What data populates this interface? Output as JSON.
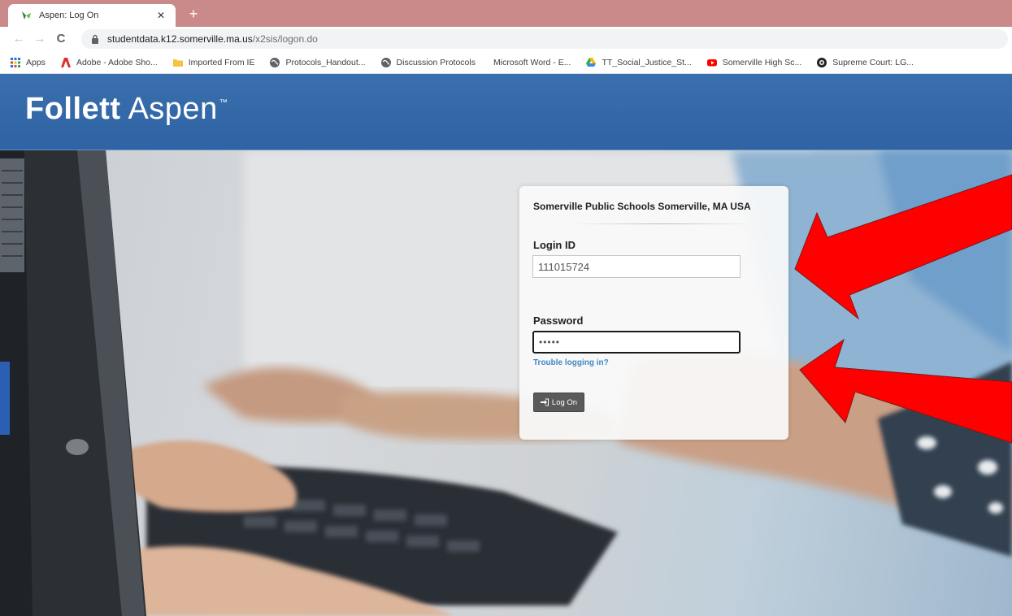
{
  "browser": {
    "tab": {
      "title": "Aspen: Log On",
      "icon": "aspen-leaf-icon",
      "close_glyph": "✕"
    },
    "new_tab_glyph": "+",
    "nav": {
      "back_glyph": "←",
      "forward_glyph": "→",
      "reload_glyph": "C"
    },
    "url": {
      "host": "studentdata.k12.somerville.ma.us",
      "path": "/x2sis/logon.do"
    },
    "bookmarks": [
      {
        "label": "Apps",
        "icon": "apps-grid-icon"
      },
      {
        "label": "Adobe - Adobe Sho...",
        "icon": "adobe-icon"
      },
      {
        "label": "Imported From IE",
        "icon": "folder-icon"
      },
      {
        "label": "Protocols_Handout...",
        "icon": "globe-icon"
      },
      {
        "label": "Discussion Protocols",
        "icon": "globe-icon"
      },
      {
        "label": "Microsoft Word - E...",
        "icon": "blank-page-icon"
      },
      {
        "label": "TT_Social_Justice_St...",
        "icon": "drive-icon"
      },
      {
        "label": "Somerville High Sc...",
        "icon": "youtube-icon"
      },
      {
        "label": "Supreme Court: LG...",
        "icon": "eye-icon"
      }
    ],
    "colors": {
      "tabstrip": "#c98a89"
    }
  },
  "header": {
    "logo_bold": "Follett",
    "logo_light": "Aspen",
    "logo_tm": "™",
    "color": "#3a6fae"
  },
  "login": {
    "organization": "Somerville Public Schools Somerville, MA USA",
    "login_label": "Login ID",
    "login_value": "111015724",
    "password_label": "Password",
    "password_value": "•••••",
    "trouble_link": "Trouble logging in?",
    "logon_button": "Log On"
  },
  "annotations": {
    "arrow_color": "#ff0000",
    "arrow_count": 2
  }
}
